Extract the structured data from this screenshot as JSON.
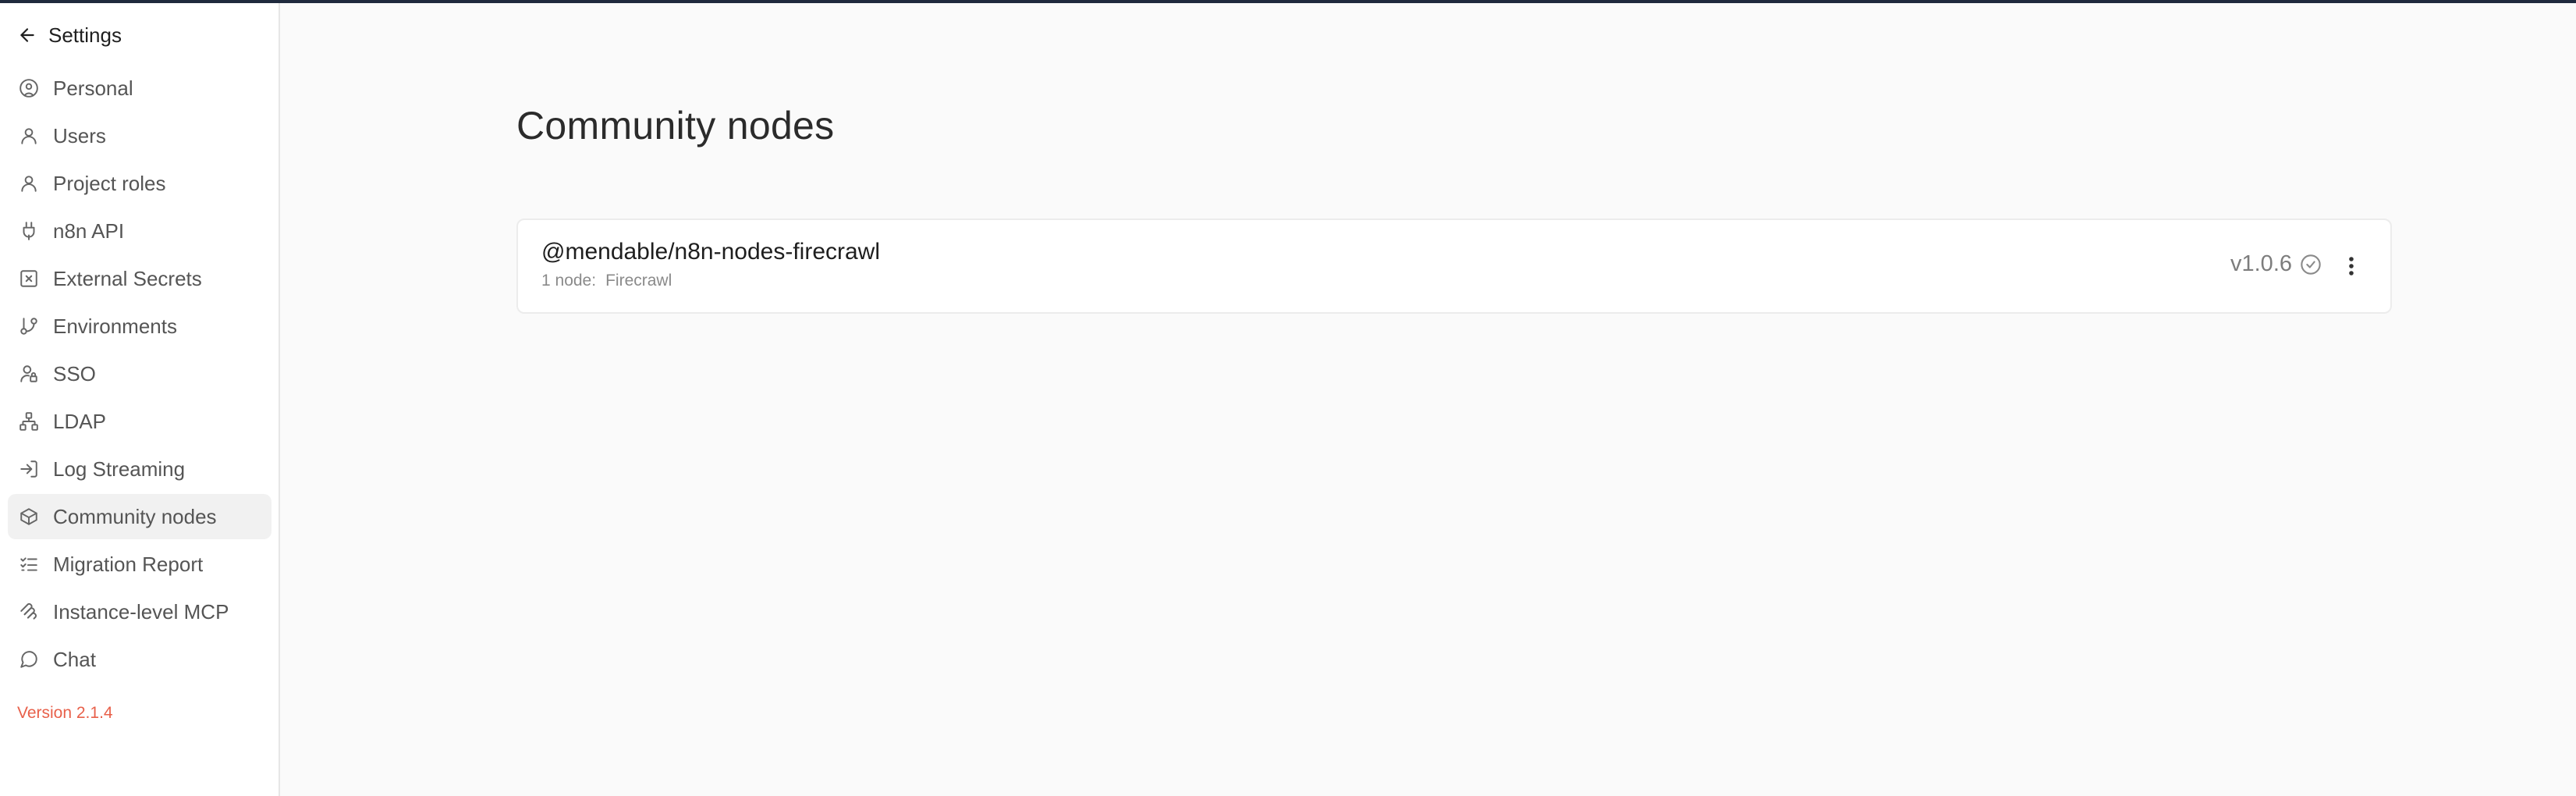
{
  "sidebar": {
    "back_label": "Settings",
    "items": [
      {
        "label": "Personal",
        "icon": "user-circle-icon",
        "active": false
      },
      {
        "label": "Users",
        "icon": "user-icon",
        "active": false
      },
      {
        "label": "Project roles",
        "icon": "user-icon",
        "active": false
      },
      {
        "label": "n8n API",
        "icon": "plug-icon",
        "active": false
      },
      {
        "label": "External Secrets",
        "icon": "square-x-icon",
        "active": false
      },
      {
        "label": "Environments",
        "icon": "git-branch-icon",
        "active": false
      },
      {
        "label": "SSO",
        "icon": "user-lock-icon",
        "active": false
      },
      {
        "label": "LDAP",
        "icon": "network-icon",
        "active": false
      },
      {
        "label": "Log Streaming",
        "icon": "log-in-icon",
        "active": false
      },
      {
        "label": "Community nodes",
        "icon": "box-icon",
        "active": true
      },
      {
        "label": "Migration Report",
        "icon": "list-checks-icon",
        "active": false
      },
      {
        "label": "Instance-level MCP",
        "icon": "mcp-icon",
        "active": false
      },
      {
        "label": "Chat",
        "icon": "message-circle-icon",
        "active": false
      }
    ],
    "version": "Version 2.1.4"
  },
  "main": {
    "title": "Community nodes",
    "packages": [
      {
        "name": "@mendable/n8n-nodes-firecrawl",
        "node_count": "1 node:",
        "nodes": "Firecrawl",
        "version": "v1.0.6"
      }
    ]
  },
  "colors": {
    "version_text": "#e8604a",
    "top_bar": "#1f2a3d",
    "active_item_bg": "#f1f1f1"
  }
}
